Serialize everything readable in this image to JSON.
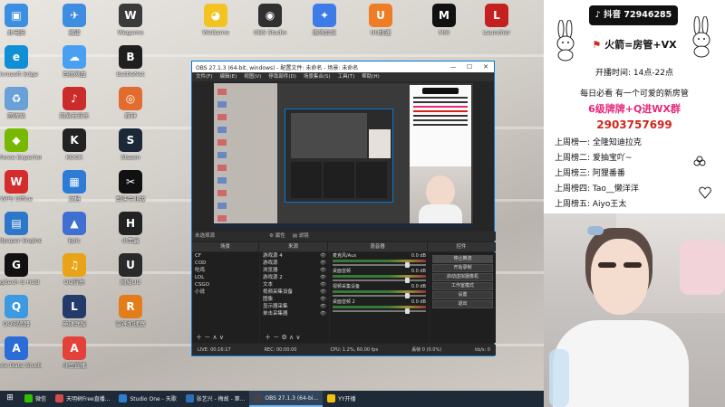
{
  "desktop": {
    "icons": [
      {
        "label": "此电脑",
        "color": "#3c8ee0",
        "glyph": "▣"
      },
      {
        "label": "Microsoft Edge",
        "color": "#0f8fd6",
        "glyph": "e"
      },
      {
        "label": "回收站",
        "color": "#6aa0d8",
        "glyph": "♻"
      },
      {
        "label": "GeForce Experience",
        "color": "#76b900",
        "glyph": "◆"
      },
      {
        "label": "WPS Office",
        "color": "#d42c2c",
        "glyph": "W"
      },
      {
        "label": "Wallpaper Engine",
        "color": "#2d77c8",
        "glyph": "▤"
      },
      {
        "label": "Logitech G HUB",
        "color": "#111111",
        "glyph": "G"
      },
      {
        "label": "QQ浏览器",
        "color": "#3b9ae1",
        "glyph": "Q"
      },
      {
        "label": "Azure Data Studio",
        "color": "#2a6dd6",
        "glyph": "A"
      },
      {
        "label": "迅雷",
        "color": "#3d8de0",
        "glyph": "✈"
      },
      {
        "label": "百度网盘",
        "color": "#4aa0f0",
        "glyph": "☁"
      },
      {
        "label": "网易云音乐",
        "color": "#cc2b2b",
        "glyph": "♪"
      },
      {
        "label": "KOOK",
        "color": "#222222",
        "glyph": "K"
      },
      {
        "label": "文档",
        "color": "#2d7bd6",
        "glyph": "▦"
      },
      {
        "label": "Epic",
        "color": "#3f6fd1",
        "glyph": "▲"
      },
      {
        "label": "QQ音乐",
        "color": "#e8a317",
        "glyph": "♫"
      },
      {
        "label": "英雄联盟",
        "color": "#233a6b",
        "glyph": "L"
      },
      {
        "label": "斗鱼直播",
        "color": "#e3413a",
        "glyph": "A"
      },
      {
        "label": "Wegame",
        "color": "#3a3a3a",
        "glyph": "W"
      },
      {
        "label": "BattleNet",
        "color": "#1f1f1f",
        "glyph": "B"
      },
      {
        "label": "原神",
        "color": "#e26c2d",
        "glyph": "◎"
      },
      {
        "label": "Steam",
        "color": "#1b2838",
        "glyph": "S"
      },
      {
        "label": "剪映专业版",
        "color": "#111111",
        "glyph": "✂"
      },
      {
        "label": "小黑盒",
        "color": "#222222",
        "glyph": "H"
      },
      {
        "label": "网易UU",
        "color": "#2a2a2a",
        "glyph": "U"
      },
      {
        "label": "雷神加速器",
        "color": "#e37d1b",
        "glyph": "R"
      }
    ],
    "top_icons": [
      {
        "label": "WeGame",
        "color": "#f3c322",
        "glyph": "◕"
      },
      {
        "label": "OBS Studio",
        "color": "#303030",
        "glyph": "◉"
      },
      {
        "label": "腾讯会议",
        "color": "#3d7be8",
        "glyph": "✦"
      },
      {
        "label": "UU加速",
        "color": "#ee7d25",
        "glyph": "U"
      },
      {
        "label": "Launcher",
        "color": "#c42020",
        "glyph": "L"
      },
      {
        "label": "MSI",
        "color": "#111111",
        "glyph": "M"
      }
    ]
  },
  "obs": {
    "title": "OBS 27.1.3 (64-bit, windows) - 配置文件: 未命名 - 场景: 未命名",
    "menu": [
      "文件(F)",
      "编辑(E)",
      "视图(V)",
      "停靠部件(D)",
      "场景集合(S)",
      "工具(T)",
      "帮助(H)"
    ],
    "no_source": "未选择源",
    "properties_btn": "属性",
    "filters_btn": "滤镜",
    "docks": {
      "scenes": "场景",
      "sources": "来源",
      "mixer": "混音器",
      "transitions": "转场特效",
      "controls": "控件"
    },
    "scenes": [
      "CF",
      "COD",
      "吃鸡",
      "LOL",
      "CSGO",
      "小说"
    ],
    "sources": [
      "游戏源 4",
      "游戏源",
      "浏览器",
      "游戏源 2",
      "文本",
      "视频采集设备",
      "图像",
      "显示器采集",
      "单击采集器"
    ],
    "mixer": [
      {
        "name": "麦克风/Aux",
        "db": "0.0 dB"
      },
      {
        "name": "桌面音频",
        "db": "0.0 dB"
      },
      {
        "name": "视频采集设备",
        "db": "0.0 dB"
      },
      {
        "name": "桌面音频 2",
        "db": "0.0 dB"
      }
    ],
    "controls": [
      "停止推流",
      "开始录制",
      "启动虚拟摄像机",
      "工作室模式",
      "设置",
      "退出"
    ],
    "status": {
      "live": "LIVE: 00:16:17",
      "rec": "REC: 00:00:00",
      "cpu": "CPU: 1.2%, 60.00 fps",
      "drop": "丢帧 0 (0.0%)",
      "kbps": "kb/s: 0"
    }
  },
  "stream": {
    "tiktok": "抖音 72946285",
    "banner": "火箭=房管+VX",
    "hours": "开播时间: 14点-22点",
    "line1": "每日必看 有一个可爱的新房管",
    "line2": "6级牌牌+Q进WX群",
    "qq": "2903757699",
    "ranks": [
      "上周榜一: 全隆知迪拉克",
      "上周榜二: 爱抽宝吖~",
      "上周榜三: 阿狸番番",
      "上周榜四: Tao__懒洋洋",
      "上周榜五: Aiyo王太"
    ]
  },
  "taskbar": {
    "items": [
      {
        "label": "微信",
        "color": "#2dc100",
        "active": false
      },
      {
        "label": "天明树Free直播...",
        "color": "#d34a4a",
        "active": false
      },
      {
        "label": "Studio One - 天歌",
        "color": "#2c7fd0",
        "active": false
      },
      {
        "label": "张艺兴 - 梅故 - 第...",
        "color": "#2b6fb6",
        "active": false
      },
      {
        "label": "OBS 27.1.3 (64-bi...",
        "color": "#444444",
        "active": true
      },
      {
        "label": "YY开播",
        "color": "#f2c10f",
        "active": false
      }
    ]
  },
  "colors": {
    "accent": "#0078d7",
    "obs_bg": "#262626",
    "pink": "#e7277b",
    "red": "#d0271c",
    "taskbar": "#1e2a38"
  }
}
